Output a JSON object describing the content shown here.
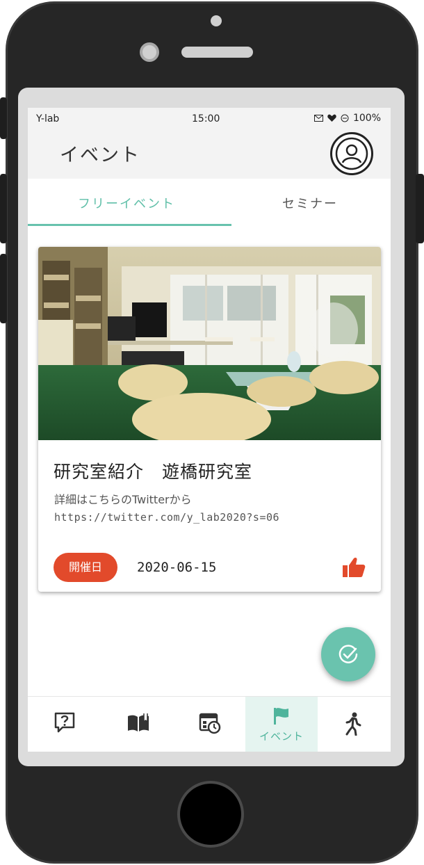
{
  "status_bar": {
    "carrier": "Y-lab",
    "time": "15:00",
    "battery": "100%"
  },
  "header": {
    "title": "イベント"
  },
  "tabs": [
    {
      "label": "フリーイベント",
      "active": true
    },
    {
      "label": "セミナー",
      "active": false
    }
  ],
  "event_card": {
    "title": "研究室紹介　遊橋研究室",
    "description": "詳細はこちらのTwitterから",
    "url": "https://twitter.com/y_lab2020?s=06",
    "badge": "開催日",
    "date": "2020-06-15"
  },
  "bottom_nav": {
    "active_label": "イベント",
    "items": [
      "help-icon",
      "book-icon",
      "schedule-icon",
      "flag-icon",
      "walk-icon"
    ]
  },
  "colors": {
    "accent": "#67c2ad",
    "badge": "#e24a2b",
    "like": "#e24a2b"
  }
}
